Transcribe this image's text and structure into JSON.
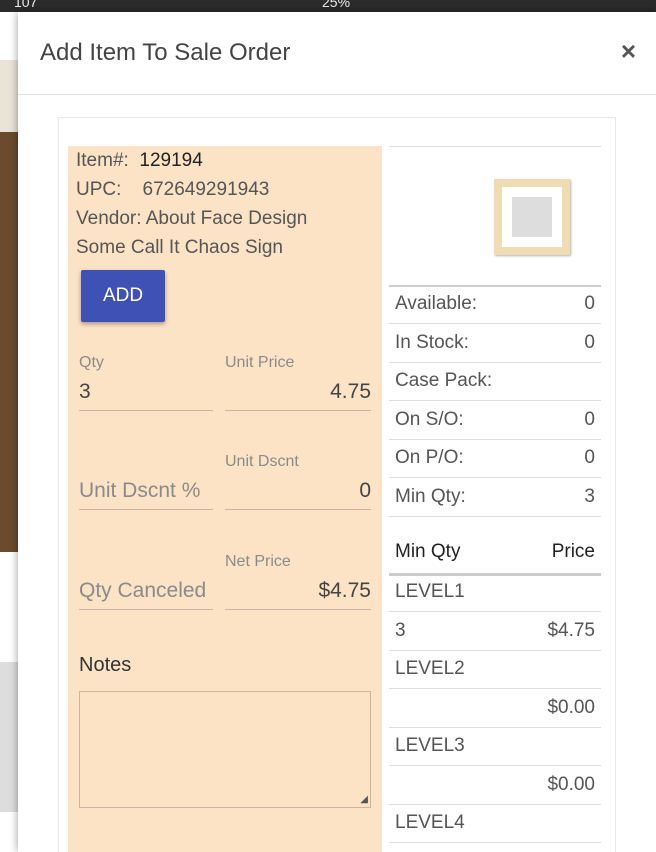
{
  "background_toolbar": {
    "page_number": "107",
    "zoom": "25%"
  },
  "modal": {
    "title": "Add Item To Sale Order",
    "close_label": "×"
  },
  "item": {
    "item_label": "Item#:",
    "item_number": "129194",
    "upc_label": "UPC:",
    "upc": "672649291943",
    "vendor_line": "Vendor: About Face Design",
    "description": "Some Call It Chaos Sign"
  },
  "add_button": "ADD",
  "fields": {
    "qty": {
      "label": "Qty",
      "value": "3"
    },
    "unit_price": {
      "label": "Unit Price",
      "value": "4.75"
    },
    "unit_dscnt_pct": {
      "placeholder": "Unit Dscnt %"
    },
    "unit_dscnt": {
      "label": "Unit Dscnt",
      "value": "0"
    },
    "qty_canceled": {
      "placeholder": "Qty Canceled"
    },
    "net_price": {
      "label": "Net Price",
      "value": "$4.75"
    }
  },
  "notes": {
    "title": "Notes",
    "value": ""
  },
  "stats": [
    {
      "label": "Available:",
      "value": "0"
    },
    {
      "label": "In Stock:",
      "value": "0"
    },
    {
      "label": "Case Pack:",
      "value": ""
    },
    {
      "label": "On S/O:",
      "value": "0"
    },
    {
      "label": "On P/O:",
      "value": "0"
    },
    {
      "label": "Min Qty:",
      "value": "3"
    }
  ],
  "price_table": {
    "headers": [
      "Min Qty",
      "Price"
    ],
    "rows": [
      {
        "left": "LEVEL1",
        "right": ""
      },
      {
        "left": "3",
        "right": "$4.75"
      },
      {
        "left": "LEVEL2",
        "right": ""
      },
      {
        "left": "",
        "right": "$0.00"
      },
      {
        "left": "LEVEL3",
        "right": ""
      },
      {
        "left": "",
        "right": "$0.00"
      },
      {
        "left": "LEVEL4",
        "right": ""
      }
    ]
  }
}
